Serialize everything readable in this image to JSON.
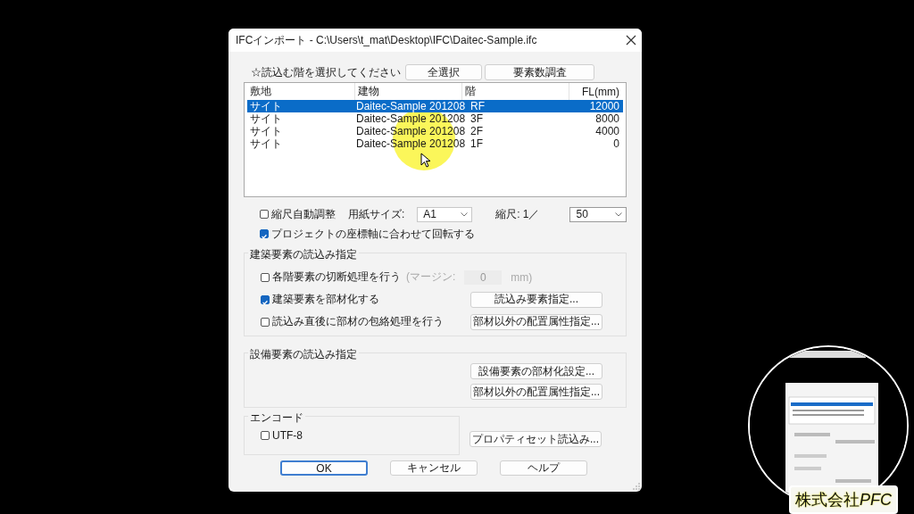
{
  "window": {
    "title": "IFCインポート - C:\\Users\\t_mat\\Desktop\\IFC\\Daitec-Sample.ifc"
  },
  "instruction": "☆読込む階を選択してください",
  "top_buttons": [
    "全選択",
    "要素数調査"
  ],
  "floor_list": {
    "columns": [
      "敷地",
      "建物",
      "階",
      "FL(mm)"
    ],
    "rows": [
      {
        "cells": [
          "サイト",
          "Daitec-Sample 201208",
          "RF",
          "12000"
        ],
        "selected": true
      },
      {
        "cells": [
          "サイト",
          "Daitec-Sample 201208",
          "3F",
          "8000"
        ],
        "selected": false
      },
      {
        "cells": [
          "サイト",
          "Daitec-Sample 201208",
          "2F",
          "4000"
        ],
        "selected": false
      },
      {
        "cells": [
          "サイト",
          "Daitec-Sample 201208",
          "1F",
          "0"
        ],
        "selected": false
      }
    ]
  },
  "scale_row": {
    "auto_scale": {
      "label": "縮尺自動調整",
      "checked": false
    },
    "paper_label": "用紙サイズ:",
    "paper_value": "A1",
    "scale_label": "縮尺: 1／",
    "scale_value": "50"
  },
  "rotate": {
    "label": "プロジェクトの座標軸に合わせて回転する",
    "checked": true
  },
  "arch_group": {
    "title": "建築要素の読込み指定",
    "rows": [
      {
        "kind": "margin",
        "label": "各階要素の切断処理を行う",
        "checked": false,
        "margin": {
          "label": "(マージン:",
          "value": "0",
          "unit": "mm)",
          "disabled": true
        }
      },
      {
        "kind": "button",
        "label": "建築要素を部材化する",
        "checked": true,
        "button": "読込み要素指定..."
      },
      {
        "kind": "button",
        "label": "読込み直後に部材の包絡処理を行う",
        "checked": false,
        "button": "部材以外の配置属性指定..."
      }
    ]
  },
  "equip_group": {
    "title": "設備要素の読込み指定",
    "buttons": [
      "設備要素の部材化設定...",
      "部材以外の配置属性指定..."
    ]
  },
  "encode_group": {
    "title": "エンコード",
    "utf8": {
      "label": "UTF-8",
      "checked": false
    }
  },
  "property_button": "プロパティセット読込み...",
  "footer_buttons": [
    {
      "label": "OK",
      "default": true
    },
    {
      "label": "キャンセル",
      "default": false
    },
    {
      "label": "ヘルプ",
      "default": false
    }
  ],
  "inset": {
    "kind": "picture"
  },
  "overlay_logo": {
    "text": "株式会社",
    "accent": "PFC"
  }
}
